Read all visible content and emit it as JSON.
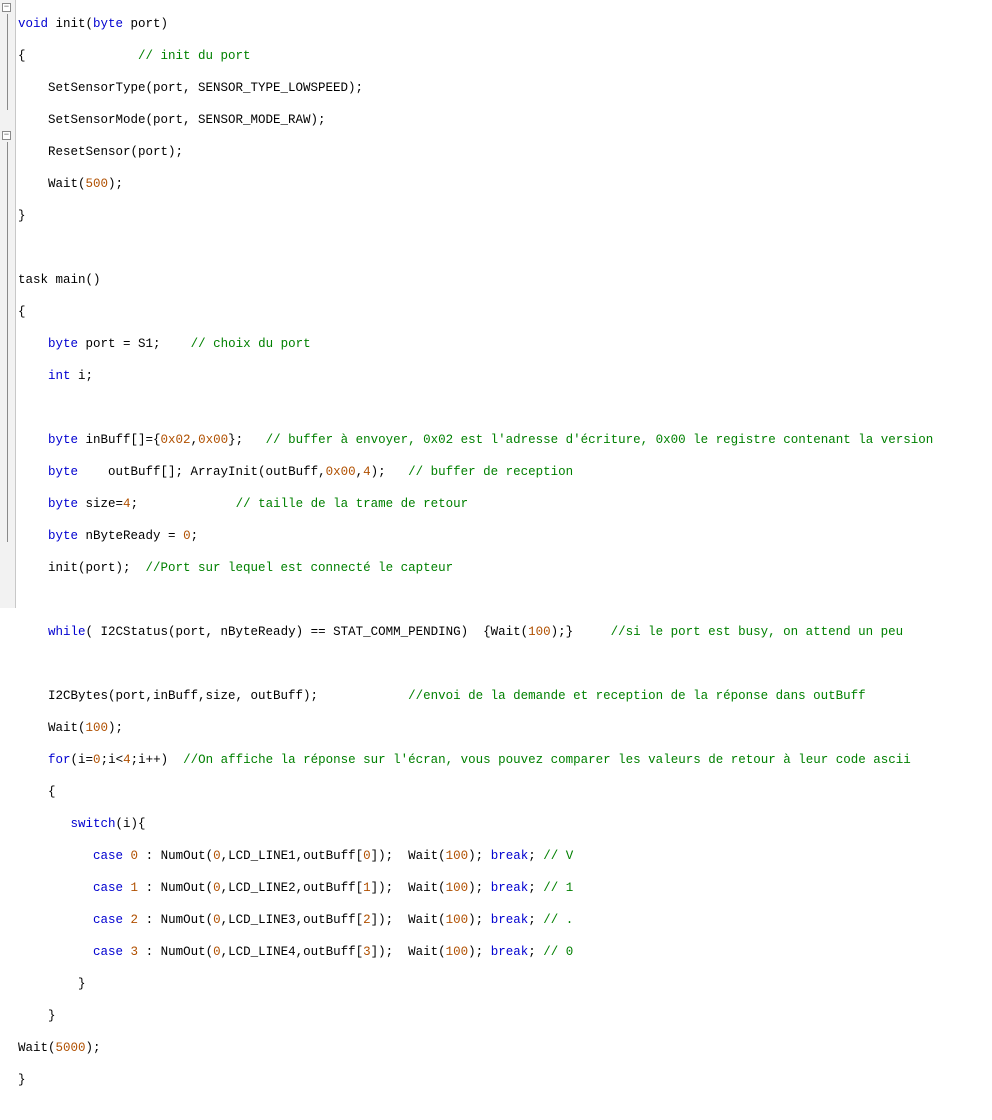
{
  "code_type": "NXC / C-like source",
  "tokens": {
    "kw_void": "void",
    "kw_byte": "byte",
    "kw_int": "int",
    "kw_while": "while",
    "kw_for": "for",
    "kw_switch": "switch",
    "kw_case": "case",
    "kw_break": "break",
    "kw_task": "task"
  },
  "code": {
    "l01_a": "void",
    "l01_b": " init(",
    "l01_c": "byte",
    "l01_d": " port)",
    "l02": "{               ",
    "l02_c": "// init du port",
    "l03": "    SetSensorType(port, SENSOR_TYPE_LOWSPEED);",
    "l04": "    SetSensorMode(port, SENSOR_MODE_RAW);",
    "l05": "    ResetSensor(port);",
    "l06a": "    Wait(",
    "l06n": "500",
    "l06b": ");",
    "l07": "}",
    "l09": "task main()",
    "l10": "{",
    "l11a": "    ",
    "l11b": " port = S1;    ",
    "l11c": "// choix du port",
    "l12a": "    ",
    "l12b": " i;",
    "l14a": "    ",
    "l14b": " inBuff[]={",
    "l14n1": "0x02",
    "l14s": ",",
    "l14n2": "0x00",
    "l14c": "};   ",
    "l14cm": "// buffer à envoyer, 0x02 est l'adresse d'écriture, 0x00 le registre contenant la version",
    "l15a": "    ",
    "l15b": "    outBuff[]; ArrayInit(outBuff,",
    "l15n1": "0x00",
    "l15c": ",",
    "l15n2": "4",
    "l15d": ");   ",
    "l15cm": "// buffer de reception",
    "l16a": "    ",
    "l16b": " size=",
    "l16n": "4",
    "l16c": ";             ",
    "l16cm": "// taille de la trame de retour",
    "l17a": "    ",
    "l17b": " nByteReady = ",
    "l17n": "0",
    "l17c": ";",
    "l18a": "    init(port);  ",
    "l18cm": "//Port sur lequel est connecté le capteur",
    "l20a": "    ",
    "l20b": "( I2CStatus(port, nByteReady) == STAT_COMM_PENDING)  {Wait(",
    "l20n": "100",
    "l20c": ");}     ",
    "l20cm": "//si le port est busy, on attend un peu",
    "l22a": "    I2CBytes(port,inBuff,size, outBuff);            ",
    "l22cm": "//envoi de la demande et reception de la réponse dans outBuff",
    "l23a": "    Wait(",
    "l23n": "100",
    "l23b": ");",
    "l24a": "    ",
    "l24b": "(i=",
    "l24n1": "0",
    "l24c": ";i<",
    "l24n2": "4",
    "l24d": ";i++)  ",
    "l24cm": "//On affiche la réponse sur l'écran, vous pouvez comparer les valeurs de retour à leur code ascii",
    "l25": "    {",
    "l26a": "       ",
    "l26b": "(i){",
    "c0a": "          ",
    "c0n": "0",
    "c0b": " : NumOut(",
    "c0p1": "0",
    "c0c": ",LCD_LINE1,outBuff[",
    "c0p2": "0",
    "c0d": "]);  Wait(",
    "c0w": "100",
    "c0e": "); ",
    "c0f": "; ",
    "c0cm": "// V",
    "c1n": "1",
    "c1c": ",LCD_LINE2,outBuff[",
    "c1p2": "1",
    "c1cm": "// 1",
    "c2n": "2",
    "c2c": ",LCD_LINE3,outBuff[",
    "c2p2": "2",
    "c2cm": "// .",
    "c3n": "3",
    "c3c": ",LCD_LINE4,outBuff[",
    "c3p2": "3",
    "c3cm": "// 0",
    "l31": "        }",
    "l32": "    }",
    "l33a": "Wait(",
    "l33n": "5000",
    "l33b": ");",
    "l34": "}"
  }
}
